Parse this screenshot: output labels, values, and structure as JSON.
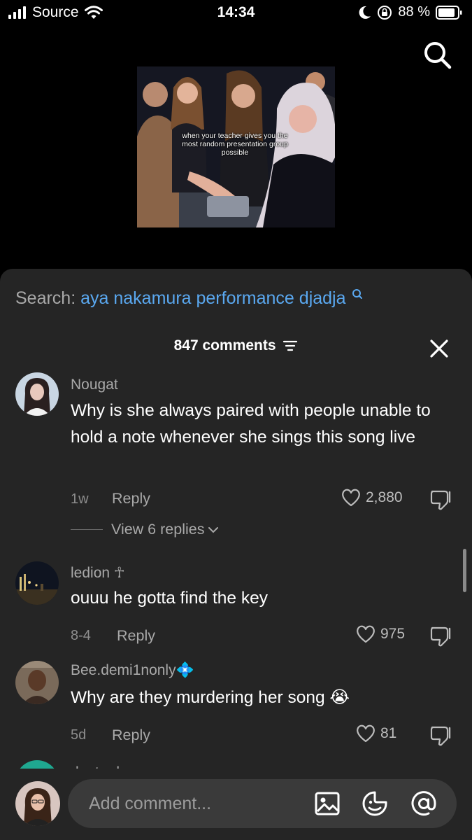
{
  "status_bar": {
    "carrier": "Source",
    "time": "14:34",
    "battery": "88 %"
  },
  "video": {
    "caption": "when your teacher gives you the most random presentation group possible"
  },
  "search": {
    "label": "Search:",
    "query": "aya nakamura performance djadja"
  },
  "comments_header": {
    "count_label": "847 comments"
  },
  "comments": [
    {
      "user": "Nougat",
      "text": "Why is she always paired with people unable to hold a note whenever she sings this song live",
      "date": "1w",
      "reply": "Reply",
      "likes": "2,880",
      "view_replies": "View 6 replies"
    },
    {
      "user": "ledion ☥",
      "text": "ouuu he gotta find the key",
      "date": "8-4",
      "reply": "Reply",
      "likes": "975"
    },
    {
      "user": "Bee.demi1nonly💠",
      "text": "Why are they murdering her song 😭",
      "date": "5d",
      "reply": "Reply",
      "likes": "81"
    }
  ],
  "partial_comment": {
    "user": "dante.deca..."
  },
  "composer": {
    "placeholder": "Add comment..."
  },
  "icons": {
    "status": [
      "signal-icon",
      "wifi-icon",
      "moon-icon",
      "rotation-lock-icon",
      "battery-icon"
    ],
    "top": "search-icon",
    "composer": [
      "image-icon",
      "emoji-icon",
      "mention-icon"
    ]
  },
  "colors": {
    "sheet_bg": "#252525",
    "link_blue": "#5aa8f0",
    "muted_text": "#a9a9a9"
  }
}
